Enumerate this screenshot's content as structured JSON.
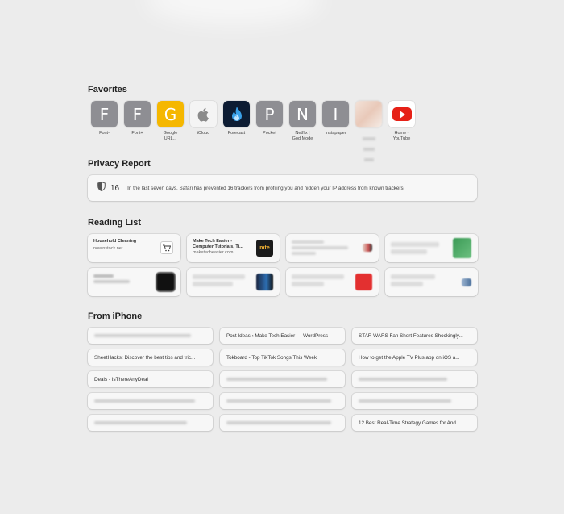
{
  "favorites_title": "Favorites",
  "favorites": [
    {
      "letter": "F",
      "label": "Font-",
      "color": "#8e8e93"
    },
    {
      "letter": "F",
      "label": "Font+",
      "color": "#8e8e93"
    },
    {
      "letter": "G",
      "label": "Google\nURL...",
      "color": "#f5b700"
    },
    {
      "letter": "",
      "label": "iCloud",
      "color": "#f4f4f4"
    },
    {
      "letter": "",
      "label": "Forecast",
      "color": "#0d1c33"
    },
    {
      "letter": "P",
      "label": "Pocket",
      "color": "#8e8e93"
    },
    {
      "letter": "N",
      "label": "Netflix |\nGod Mode",
      "color": "#8e8e93"
    },
    {
      "letter": "I",
      "label": "Instapaper",
      "color": "#8e8e93"
    },
    {
      "letter": "",
      "label": "",
      "color": "#f0d8cc"
    },
    {
      "letter": "",
      "label": "Home -\nYouTube",
      "color": "#ffffff"
    }
  ],
  "privacy_title": "Privacy Report",
  "privacy": {
    "count": "16",
    "text": "In the last seven days, Safari has prevented 16 trackers from profiling you and hidden your IP address from known trackers."
  },
  "reading_title": "Reading List",
  "reading": [
    {
      "title": "Household Cleaning",
      "sub": "nowinstock.net",
      "thumb": "cart"
    },
    {
      "title": "Make Tech Easier - Computer Tutorials, Ti...",
      "sub": "maketecheasier.com",
      "thumb": "mte"
    }
  ],
  "iphone_title": "From iPhone",
  "iphone": [
    "",
    "Post Ideas ‹ Make Tech Easier — WordPress",
    "STAR WARS Fan Short Features Shockingly...",
    "SheetHacks: Discover the best tips and tric...",
    "Tokboard - Top TikTok Songs This Week",
    "How to get the Apple TV Plus app on iOS a...",
    "Deals - IsThereAnyDeal",
    "",
    "",
    "",
    "",
    "",
    "",
    "",
    "12 Best Real-Time Strategy Games for And..."
  ],
  "colors": {
    "background": "#ececec",
    "card": "#f7f7f7",
    "youtube_red": "#e62117"
  }
}
